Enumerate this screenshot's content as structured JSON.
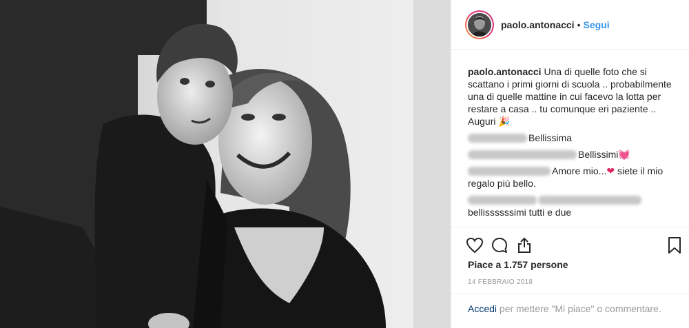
{
  "post": {
    "photo_label": "",
    "author": "paolo.antonacci",
    "dot": "•",
    "follow_label": "Segui",
    "caption": {
      "username": "paolo.antonacci",
      "text": "Una di quelle foto che si scattano i primi giorni di scuola .. probabilmente una di quelle mattine in cui facevo la lotta per restare a casa .. tu comunque eri paziente .. Auguri",
      "emoji": "🎉"
    },
    "comments": [
      {
        "user_hidden": true,
        "text": "Bellissima"
      },
      {
        "user_hidden": true,
        "text": "Bellissimi",
        "emoji": "💓"
      },
      {
        "user_hidden": true,
        "text": "Amore mio...",
        "emoji": "❤",
        "text_after": "siete il mio regalo più bello."
      },
      {
        "user_hidden": true,
        "mention_hidden": true,
        "text": "bellissssssimi tutti e due"
      }
    ],
    "likes_text": "Piace a 1.757 persone",
    "date": "14 FEBBRAIO 2018",
    "login": {
      "link": "Accedi",
      "text": " per mettere \"Mi piace\" o commentare."
    },
    "icons": [
      "heart-icon",
      "comment-icon",
      "share-icon",
      "bookmark-icon"
    ],
    "colors": {
      "link": "#3897f0",
      "text": "#262626",
      "muted": "#999999",
      "heart": "#e0245e"
    }
  }
}
